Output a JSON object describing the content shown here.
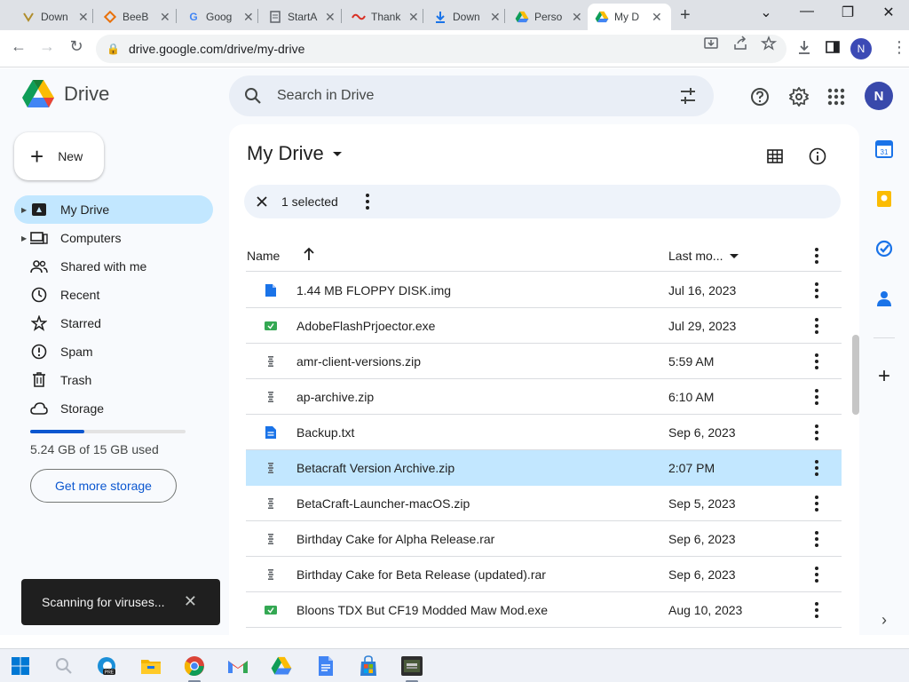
{
  "browser": {
    "tabs": [
      {
        "title": "Down",
        "icon": "download-icon"
      },
      {
        "title": "BeeB",
        "icon": "beebom-icon"
      },
      {
        "title": "Goog",
        "icon": "google-icon"
      },
      {
        "title": "StartA",
        "icon": "page-icon"
      },
      {
        "title": "Thank",
        "icon": "thanks-icon"
      },
      {
        "title": "Down",
        "icon": "download-arrow-icon"
      },
      {
        "title": "Perso",
        "icon": "drive-icon"
      },
      {
        "title": "My D",
        "icon": "drive-icon",
        "active": true
      }
    ],
    "url": "drive.google.com/drive/my-drive",
    "profile_initial": "N"
  },
  "app": {
    "name": "Drive",
    "search_placeholder": "Search in Drive",
    "avatar_initial": "N",
    "new_label": "New",
    "nav": [
      {
        "label": "My Drive",
        "icon": "my-drive-icon",
        "active": true,
        "caret": true
      },
      {
        "label": "Computers",
        "icon": "computer-icon",
        "caret": true
      },
      {
        "label": "Shared with me",
        "icon": "people-icon"
      },
      {
        "label": "Recent",
        "icon": "clock-icon"
      },
      {
        "label": "Starred",
        "icon": "star-icon"
      },
      {
        "label": "Spam",
        "icon": "spam-icon"
      },
      {
        "label": "Trash",
        "icon": "trash-icon"
      },
      {
        "label": "Storage",
        "icon": "cloud-icon"
      }
    ],
    "storage": {
      "used_fraction": 0.35,
      "text": "5.24 GB of 15 GB used",
      "button": "Get more storage"
    },
    "toast": "Scanning for viruses..."
  },
  "main": {
    "title": "My Drive",
    "selection": "1 selected",
    "columns": {
      "name": "Name",
      "modified": "Last mo..."
    },
    "files": [
      {
        "name": "1.44 MB FLOPPY DISK.img",
        "date": "Jul 16, 2023",
        "type": "file",
        "color": "#1a73e8"
      },
      {
        "name": "AdobeFlashPrjoector.exe",
        "date": "Jul 29, 2023",
        "type": "exe",
        "color": "#34a853"
      },
      {
        "name": "amr-client-versions.zip",
        "date": "5:59 AM",
        "type": "zip",
        "color": "#5f6368"
      },
      {
        "name": "ap-archive.zip",
        "date": "6:10 AM",
        "type": "zip",
        "color": "#5f6368"
      },
      {
        "name": "Backup.txt",
        "date": "Sep 6, 2023",
        "type": "doc",
        "color": "#1a73e8"
      },
      {
        "name": "Betacraft Version Archive.zip",
        "date": "2:07 PM",
        "type": "zip",
        "color": "#5f6368",
        "selected": true
      },
      {
        "name": "BetaCraft-Launcher-macOS.zip",
        "date": "Sep 5, 2023",
        "type": "zip",
        "color": "#5f6368"
      },
      {
        "name": "Birthday Cake for Alpha Release.rar",
        "date": "Sep 6, 2023",
        "type": "zip",
        "color": "#5f6368"
      },
      {
        "name": "Birthday Cake for Beta Release (updated).rar",
        "date": "Sep 6, 2023",
        "type": "zip",
        "color": "#5f6368"
      },
      {
        "name": "Bloons TDX But CF19 Modded Maw Mod.exe",
        "date": "Aug 10, 2023",
        "type": "exe",
        "color": "#34a853"
      }
    ]
  },
  "colors": {
    "accent": "#0b57d0",
    "selected_row": "#c2e7ff",
    "active_nav": "#c2e7ff"
  }
}
